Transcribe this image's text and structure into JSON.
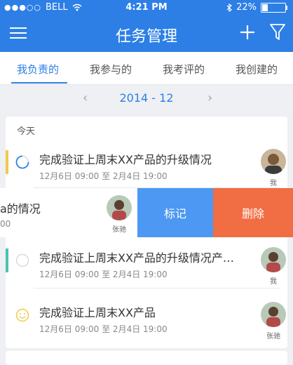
{
  "status_bar": {
    "carrier": "BELL",
    "time": "4:21 PM",
    "battery": "22%"
  },
  "nav": {
    "title": "任务管理"
  },
  "tabs": [
    {
      "label": "我负责的",
      "active": true
    },
    {
      "label": "我参与的",
      "active": false
    },
    {
      "label": "我考评的",
      "active": false
    },
    {
      "label": "我创建的",
      "active": false
    }
  ],
  "month_nav": {
    "month": "2014 - 12",
    "prev": "‹",
    "next": "›"
  },
  "section": {
    "label": "今天"
  },
  "tasks": [
    {
      "title": "完成验证上周末XX产品的升级情况",
      "time": "12月6日 09:00  至  2月4日  19:00",
      "assignee": "我",
      "status": "in-progress",
      "accent": "#f2c94c"
    },
    {
      "title": "a的情况",
      "time": "00",
      "assignee": "张驰",
      "status": "swiped"
    },
    {
      "title": "完成验证上周末XX产品的升级情况产…",
      "time": "12月6日 09:00  至  2月4日  19:00",
      "assignee": "我",
      "status": "not-started",
      "accent": "#4ac3b4"
    },
    {
      "title": "完成验证上周末XX产品",
      "time": "12月6日 09:00  至  2月4日  19:00",
      "assignee": "张驰",
      "status": "smile"
    }
  ],
  "swipe_actions": {
    "mark": "标记",
    "delete": "删除"
  },
  "colors": {
    "primary": "#2d7fe6",
    "mark": "#4c98f3",
    "delete": "#f16d43"
  }
}
